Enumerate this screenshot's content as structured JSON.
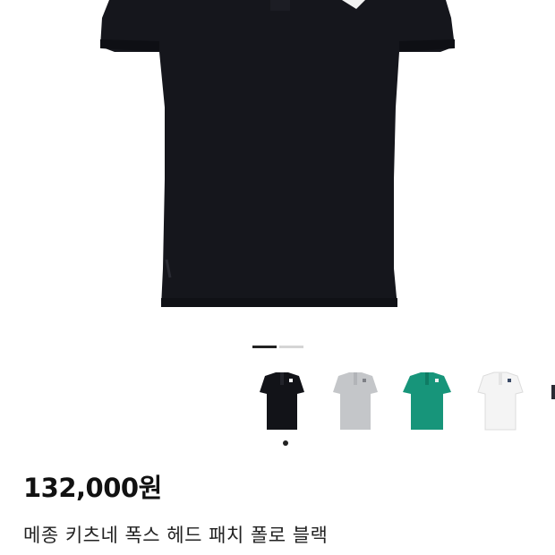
{
  "product": {
    "price": "132,000원",
    "name": "메종 키츠네 폭스 헤드 패치 폴로 블랙"
  },
  "gallery": {
    "page_count": 2,
    "active_page": 1
  },
  "colors": {
    "shirt_black": "#15161c",
    "swatch_black": "#121318",
    "swatch_grey": "#c4c6c9",
    "swatch_green": "#17957a",
    "swatch_white": "#f4f4f4",
    "dot": "#222222"
  },
  "swatches": [
    {
      "color_name": "black",
      "selected": true
    },
    {
      "color_name": "grey",
      "selected": false
    },
    {
      "color_name": "green",
      "selected": false
    },
    {
      "color_name": "white",
      "selected": false
    }
  ]
}
